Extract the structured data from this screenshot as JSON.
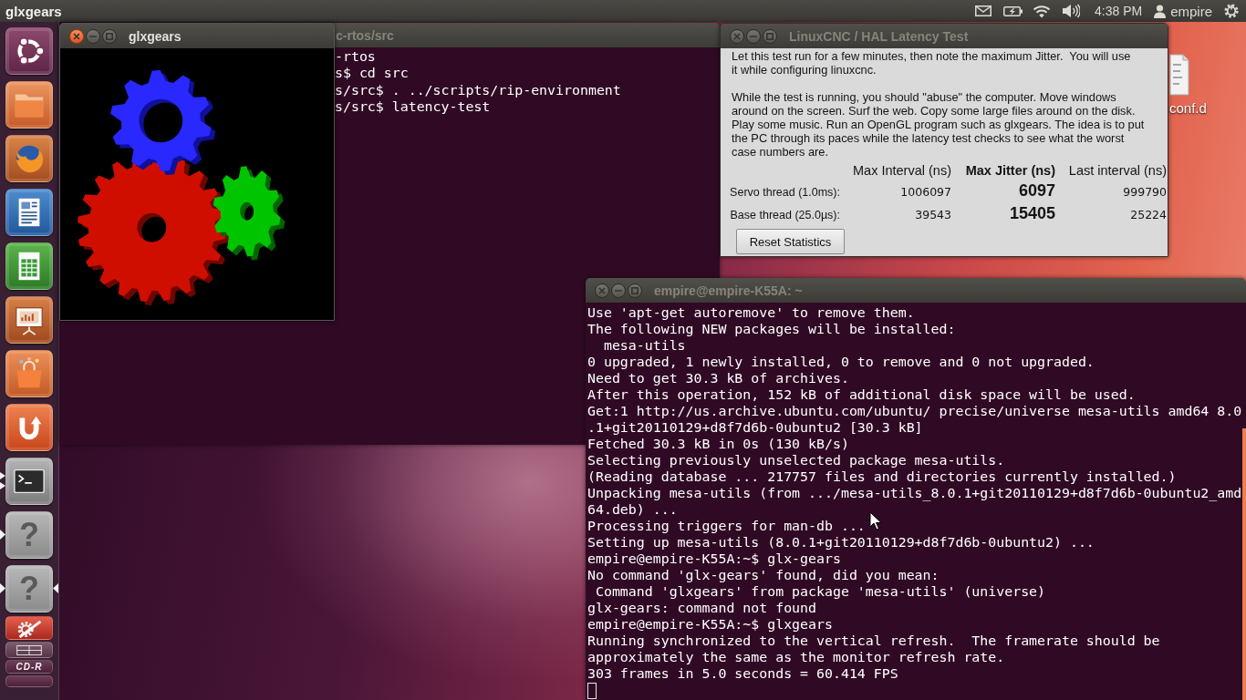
{
  "top_panel": {
    "app_title": "glxgears",
    "clock": "4:38 PM",
    "user": "empire"
  },
  "launcher": {
    "items": [
      {
        "kind": "dash",
        "running": false,
        "multiple_windows": false,
        "focused": false
      },
      {
        "kind": "files",
        "running": false,
        "multiple_windows": false,
        "focused": false
      },
      {
        "kind": "browser",
        "running": false,
        "multiple_windows": false,
        "focused": false
      },
      {
        "kind": "writer",
        "running": false,
        "multiple_windows": false,
        "focused": false
      },
      {
        "kind": "calc",
        "running": false,
        "multiple_windows": false,
        "focused": false
      },
      {
        "kind": "impress",
        "running": false,
        "multiple_windows": false,
        "focused": false
      },
      {
        "kind": "software",
        "running": false,
        "multiple_windows": false,
        "focused": false
      },
      {
        "kind": "cloud",
        "running": false,
        "multiple_windows": false,
        "focused": false
      },
      {
        "kind": "terminal",
        "running": true,
        "multiple_windows": true,
        "focused": false
      },
      {
        "kind": "unknown",
        "glyph": "?",
        "running": true,
        "multiple_windows": false,
        "focused": false
      },
      {
        "kind": "unknown",
        "glyph": "?",
        "running": true,
        "multiple_windows": false,
        "focused": true
      }
    ],
    "folded": [
      {
        "kind": "settings"
      },
      {
        "kind": "workspaces"
      },
      {
        "kind": "disc",
        "label": "CD-R"
      },
      {
        "kind": "trash"
      }
    ]
  },
  "background_terminal": {
    "title": "c-rtos/src",
    "focused": false,
    "lines": [
      "-rtos",
      "s$ cd src",
      "s/src$ . ../scripts/rip-environment",
      "s/src$ latency-test"
    ]
  },
  "glxgears_window": {
    "title": "glxgears",
    "focused": true
  },
  "latency_window": {
    "title": "LinuxCNC / HAL Latency Test",
    "focused": false,
    "paragraphs": [
      "Let this test run for a few minutes, then note the maximum Jitter.  You will use\nit while configuring linuxcnc.",
      "While the test is running, you should \"abuse\" the computer. Move windows\naround on the screen. Surf the web. Copy some large files around on the disk.\nPlay some music. Run an OpenGL program such as glxgears. The idea is to put\nthe PC through its paces while the latency test checks to see what the worst\ncase numbers are."
    ],
    "table": {
      "columns": [
        {
          "label": "Max Interval (ns)",
          "emphasized": false
        },
        {
          "label": "Max Jitter (ns)",
          "emphasized": true
        },
        {
          "label": "Last interval (ns)",
          "emphasized": false
        }
      ],
      "rows": [
        {
          "label": "Servo thread (1.0ms):",
          "values": [
            "1006097",
            "6097",
            "999790"
          ]
        },
        {
          "label": "Base thread (25.0µs):",
          "values": [
            "39543",
            "15405",
            "25224"
          ]
        }
      ]
    },
    "button": "Reset Statistics"
  },
  "desktop_icons": [
    {
      "label": "conf.d"
    }
  ],
  "front_terminal": {
    "title": "empire@empire-K55A: ~",
    "focused": false,
    "lines": [
      "Use 'apt-get autoremove' to remove them.",
      "The following NEW packages will be installed:",
      "  mesa-utils",
      "0 upgraded, 1 newly installed, 0 to remove and 0 not upgraded.",
      "Need to get 30.3 kB of archives.",
      "After this operation, 152 kB of additional disk space will be used.",
      "Get:1 http://us.archive.ubuntu.com/ubuntu/ precise/universe mesa-utils amd64 8.0",
      ".1+git20110129+d8f7d6b-0ubuntu2 [30.3 kB]",
      "Fetched 30.3 kB in 0s (130 kB/s)",
      "Selecting previously unselected package mesa-utils.",
      "(Reading database ... 217757 files and directories currently installed.)",
      "Unpacking mesa-utils (from .../mesa-utils_8.0.1+git20110129+d8f7d6b-0ubuntu2_amd",
      "64.deb) ...",
      "Processing triggers for man-db ...",
      "Setting up mesa-utils (8.0.1+git20110129+d8f7d6b-0ubuntu2) ...",
      "empire@empire-K55A:~$ glx-gears",
      "No command 'glx-gears' found, did you mean:",
      " Command 'glxgears' from package 'mesa-utils' (universe)",
      "glx-gears: command not found",
      "empire@empire-K55A:~$ glxgears",
      "Running synchronized to the vertical refresh.  The framerate should be",
      "approximately the same as the monitor refresh rate.",
      "303 frames in 5.0 seconds = 60.414 FPS"
    ]
  }
}
